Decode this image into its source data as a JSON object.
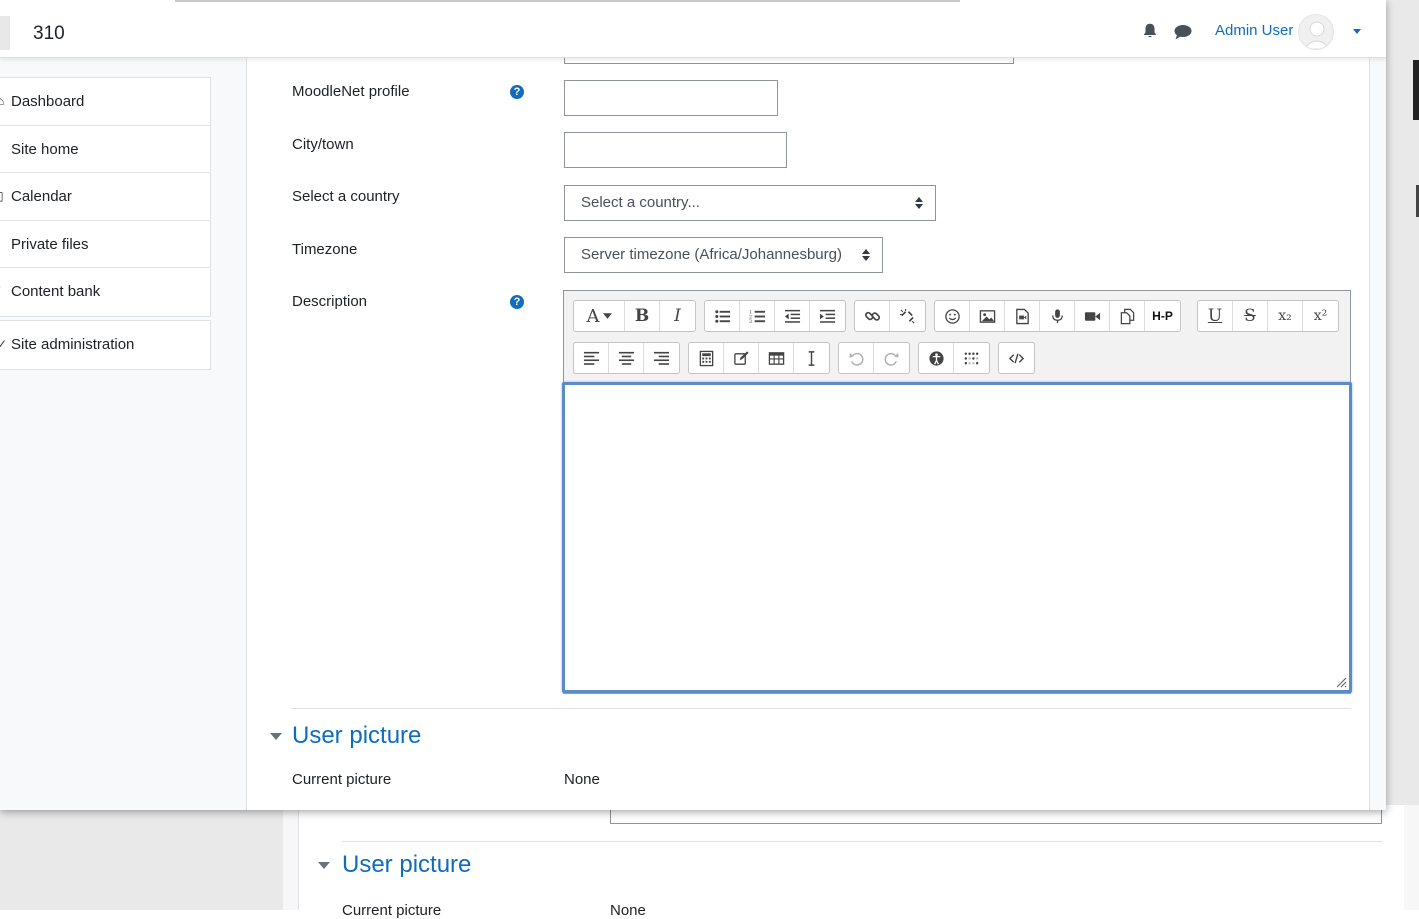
{
  "header": {
    "site_name": "310",
    "user_name": "Admin User"
  },
  "sidebar": {
    "items": [
      {
        "label": "Dashboard",
        "glyph": "⌂"
      },
      {
        "label": "Site home",
        "glyph": "·"
      },
      {
        "label": "Calendar",
        "glyph": "▯"
      },
      {
        "label": "Private files",
        "glyph": "·"
      },
      {
        "label": "Content bank",
        "glyph": "/"
      }
    ],
    "admin": {
      "label": "Site administration",
      "glyph": "✓"
    }
  },
  "form": {
    "moodlenet": {
      "label": "MoodleNet profile",
      "value": ""
    },
    "city": {
      "label": "City/town",
      "value": ""
    },
    "country": {
      "label": "Select a country",
      "selected": "Select a country..."
    },
    "timezone": {
      "label": "Timezone",
      "selected": "Server timezone (Africa/Johannesburg)"
    },
    "description": {
      "label": "Description",
      "value": ""
    }
  },
  "editor": {
    "row1": [
      "font-style",
      "bold",
      "italic",
      "unordered-list",
      "ordered-list",
      "outdent",
      "indent",
      "link",
      "unlink",
      "emoticon",
      "image",
      "media",
      "record-audio",
      "record-video",
      "manage-files",
      "h5p",
      "underline",
      "strikethrough",
      "subscript",
      "superscript"
    ],
    "row2": [
      "align-left",
      "align-center",
      "align-right",
      "equation",
      "special-character",
      "table",
      "clear-formatting",
      "undo",
      "redo",
      "accessibility-checker",
      "screenreader-helper",
      "html"
    ],
    "labels": {
      "bold": "B",
      "italic": "I",
      "underline": "U",
      "strike": "S",
      "sub": "x₂",
      "sup": "x²",
      "font": "A",
      "h5p": "H-P"
    }
  },
  "user_picture": {
    "section_title": "User picture",
    "current_label": "Current picture",
    "current_value": "None"
  },
  "colors": {
    "accent": "#0f6cbf",
    "focus": "#5a8dc8"
  }
}
